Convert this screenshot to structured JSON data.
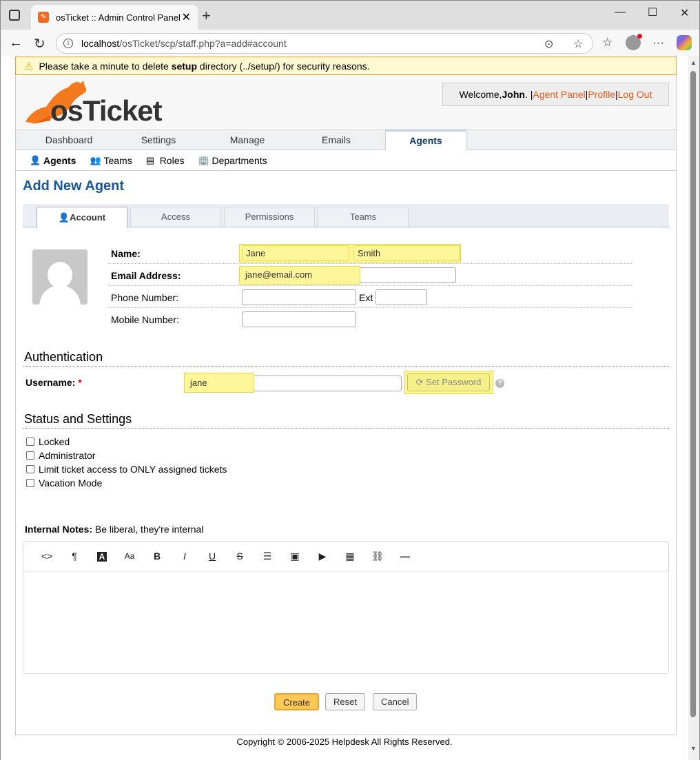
{
  "browser": {
    "tab_title": "osTicket :: Admin Control Panel",
    "url_domain": "localhost",
    "url_path": "/osTicket/scp/staff.php?a=add#account"
  },
  "warning": {
    "prefix": "Please take a minute to delete ",
    "bold": "setup",
    "suffix": " directory (../setup/) for security reasons."
  },
  "header": {
    "logo_text": "osTicket",
    "welcome_prefix": "Welcome, ",
    "user_name": "John",
    "welcome_sep": ". | ",
    "agent_panel": "Agent Panel",
    "sep": " | ",
    "profile": "Profile",
    "logout": "Log Out"
  },
  "mainnav": {
    "items": [
      "Dashboard",
      "Settings",
      "Manage",
      "Emails",
      "Agents"
    ]
  },
  "subnav": {
    "items": [
      "Agents",
      "Teams",
      "Roles",
      "Departments"
    ]
  },
  "page": {
    "title": "Add New Agent"
  },
  "form_tabs": {
    "items": [
      "Account",
      "Access",
      "Permissions",
      "Teams"
    ]
  },
  "account": {
    "name_label": "Name:",
    "first_name": "Jane",
    "last_name": "Smith",
    "email_label": "Email Address:",
    "email": "jane@email.com",
    "phone_label": "Phone Number:",
    "ext_label": "Ext",
    "mobile_label": "Mobile Number:"
  },
  "auth": {
    "heading": "Authentication",
    "username_label": "Username:",
    "required_mark": "*",
    "username": "jane",
    "set_password": "Set Password",
    "help": "?"
  },
  "status": {
    "heading": "Status and Settings",
    "options": [
      "Locked",
      "Administrator",
      "Limit ticket access to ONLY assigned tickets",
      "Vacation Mode"
    ]
  },
  "notes": {
    "label": "Internal Notes:",
    "hint": " Be liberal, they're internal"
  },
  "editor_tools": [
    "<>",
    "¶",
    "A",
    "Aa",
    "B",
    "I",
    "U",
    "S",
    "☰",
    "▣",
    "▶",
    "▦",
    "⛓",
    "—"
  ],
  "buttons": {
    "create": "Create",
    "reset": "Reset",
    "cancel": "Cancel"
  },
  "footer": {
    "text": "Copyright © 2006-2025 Helpdesk All Rights Reserved."
  },
  "colors": {
    "accent": "#18589a",
    "link": "#e55b1a",
    "highlight": "#fff69a"
  }
}
